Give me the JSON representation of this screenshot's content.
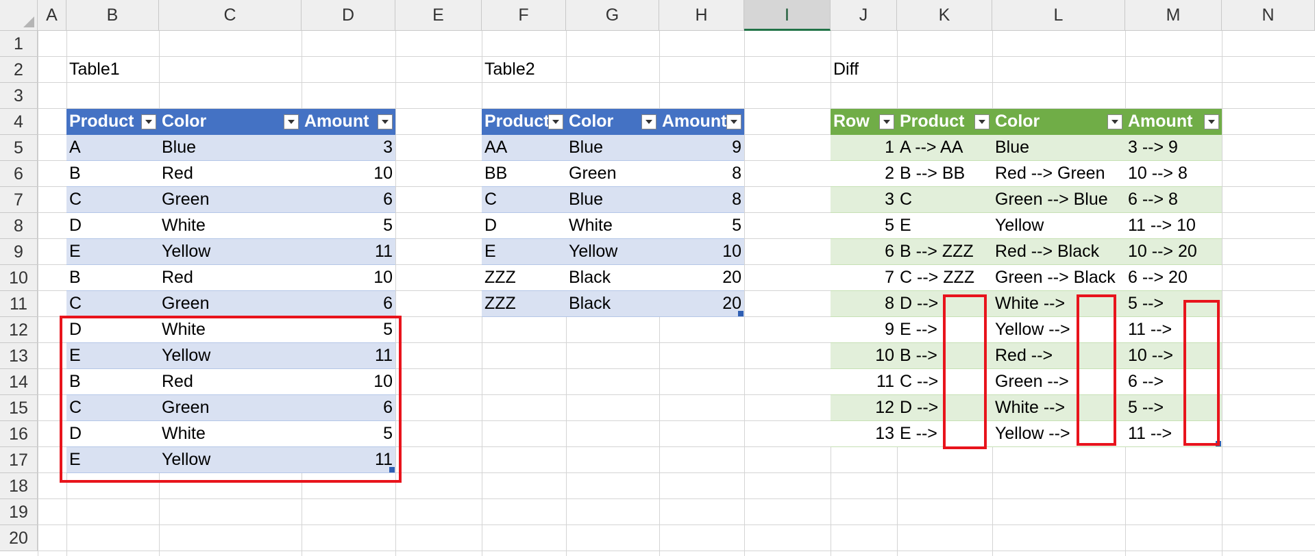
{
  "columns": [
    "A",
    "B",
    "C",
    "D",
    "E",
    "F",
    "G",
    "H",
    "I",
    "J",
    "K",
    "L",
    "M",
    "N"
  ],
  "rows": [
    "1",
    "2",
    "3",
    "4",
    "5",
    "6",
    "7",
    "8",
    "9",
    "10",
    "11",
    "12",
    "13",
    "14",
    "15",
    "16",
    "17",
    "18",
    "19",
    "20"
  ],
  "selected_column": "I",
  "labels": {
    "table1": "Table1",
    "table2": "Table2",
    "diff": "Diff"
  },
  "colors": {
    "table1_header": "#4472c4",
    "table1_band": "#d9e1f2",
    "table2_header": "#4472c4",
    "table2_band": "#d9e1f2",
    "diff_header": "#70ad47",
    "diff_band": "#e2efda",
    "highlight": "#e8141c"
  },
  "table1": {
    "headers": [
      "Product",
      "Color",
      "Amount"
    ],
    "rows": [
      [
        "A",
        "Blue",
        "3"
      ],
      [
        "B",
        "Red",
        "10"
      ],
      [
        "C",
        "Green",
        "6"
      ],
      [
        "D",
        "White",
        "5"
      ],
      [
        "E",
        "Yellow",
        "11"
      ],
      [
        "B",
        "Red",
        "10"
      ],
      [
        "C",
        "Green",
        "6"
      ],
      [
        "D",
        "White",
        "5"
      ],
      [
        "E",
        "Yellow",
        "11"
      ],
      [
        "B",
        "Red",
        "10"
      ],
      [
        "C",
        "Green",
        "6"
      ],
      [
        "D",
        "White",
        "5"
      ],
      [
        "E",
        "Yellow",
        "11"
      ]
    ]
  },
  "table2": {
    "headers": [
      "Product",
      "Color",
      "Amount"
    ],
    "rows": [
      [
        "AA",
        "Blue",
        "9"
      ],
      [
        "BB",
        "Green",
        "8"
      ],
      [
        "C",
        "Blue",
        "8"
      ],
      [
        "D",
        "White",
        "5"
      ],
      [
        "E",
        "Yellow",
        "10"
      ],
      [
        "ZZZ",
        "Black",
        "20"
      ],
      [
        "ZZZ",
        "Black",
        "20"
      ]
    ]
  },
  "diff": {
    "headers": [
      "Row",
      "Product",
      "Color",
      "Amount"
    ],
    "rows": [
      [
        "1",
        "A --> AA",
        "Blue",
        "3 --> 9"
      ],
      [
        "2",
        "B --> BB",
        "Red --> Green",
        "10 --> 8"
      ],
      [
        "3",
        "C",
        "Green --> Blue",
        "6 --> 8"
      ],
      [
        "5",
        "E",
        "Yellow",
        "11 --> 10"
      ],
      [
        "6",
        "B --> ZZZ",
        "Red --> Black",
        "10 --> 20"
      ],
      [
        "7",
        "C --> ZZZ",
        "Green --> Black",
        "6 --> 20"
      ],
      [
        "8",
        "D -->",
        "White -->",
        "5 -->"
      ],
      [
        "9",
        "E -->",
        "Yellow -->",
        "11 -->"
      ],
      [
        "10",
        "B -->",
        "Red -->",
        "10 -->"
      ],
      [
        "11",
        "C -->",
        "Green -->",
        "6 -->"
      ],
      [
        "12",
        "D -->",
        "White -->",
        "5 -->"
      ],
      [
        "13",
        "E -->",
        "Yellow -->",
        "11 -->"
      ]
    ]
  }
}
